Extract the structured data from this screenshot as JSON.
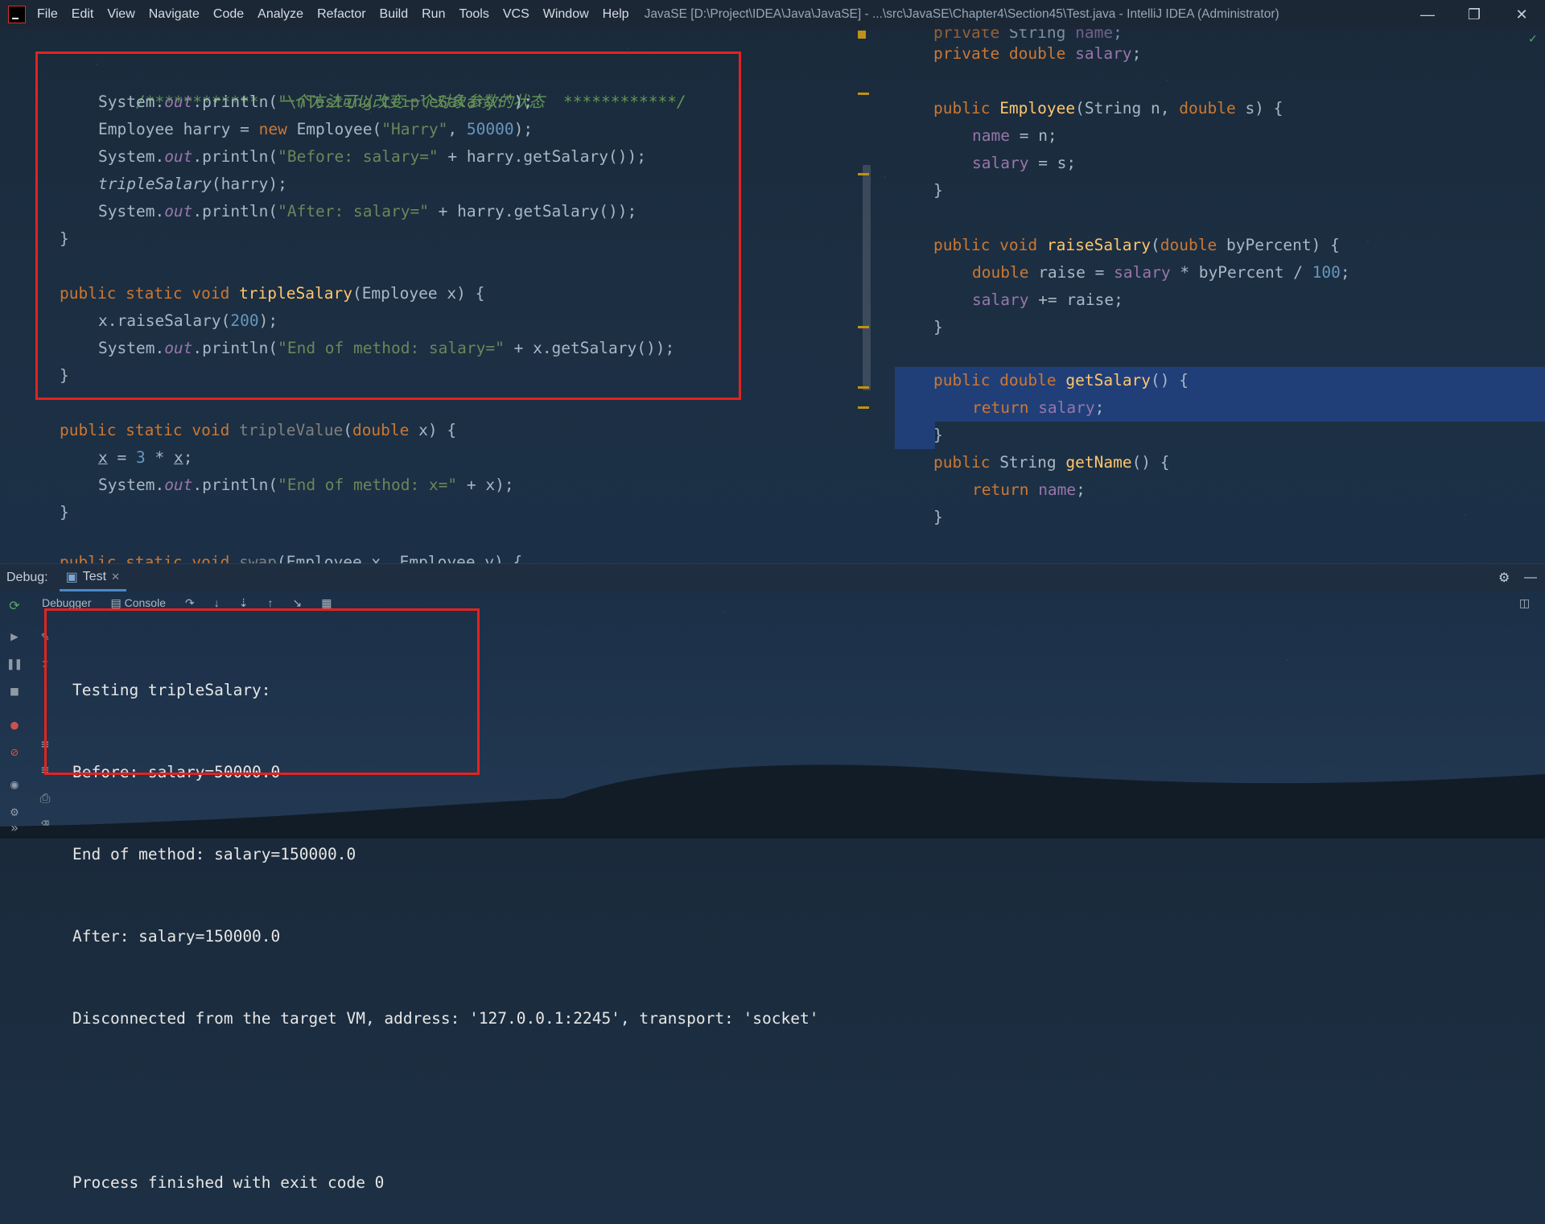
{
  "menubar": {
    "items": [
      "File",
      "Edit",
      "View",
      "Navigate",
      "Code",
      "Analyze",
      "Refactor",
      "Build",
      "Run",
      "Tools",
      "VCS",
      "Window",
      "Help"
    ],
    "title": "JavaSE [D:\\Project\\IDEA\\Java\\JavaSE] - ...\\src\\JavaSE\\Chapter4\\Section45\\Test.java - IntelliJ IDEA (Administrator)"
  },
  "editor_left": {
    "comment": "/************  一个方法可以改变一个对象参数的状态  ************/",
    "l1": {
      "a": "System.",
      "b": "out",
      "c": ".println(",
      "d": "\"\\nTesting tripleSalary:\"",
      "e": ");"
    },
    "l2": {
      "a": "Employee harry = ",
      "b": "new",
      "c": " Employee(",
      "d": "\"Harry\"",
      "e": ", ",
      "f": "50000",
      "g": ");"
    },
    "l3": {
      "a": "System.",
      "b": "out",
      "c": ".println(",
      "d": "\"Before: salary=\"",
      "e": " + harry.getSalary());"
    },
    "l4": {
      "a": "tripleSalary",
      "b": "(harry);"
    },
    "l5": {
      "a": "System.",
      "b": "out",
      "c": ".println(",
      "d": "\"After: salary=\"",
      "e": " + harry.getSalary());"
    },
    "l6": "}",
    "l7": {
      "a": "public static void ",
      "b": "tripleSalary",
      "c": "(Employee x) {"
    },
    "l8": {
      "a": "x.raiseSalary(",
      "b": "200",
      "c": ");"
    },
    "l9": {
      "a": "System.",
      "b": "out",
      "c": ".println(",
      "d": "\"End of method: salary=\"",
      "e": " + x.getSalary());"
    },
    "l10": "}",
    "l11": {
      "a": "public static void ",
      "b": "tripleValue",
      "c": "(",
      "d": "double",
      "e": " x) {"
    },
    "l12": {
      "a": "x",
      "b": " = ",
      "c": "3",
      "d": " * ",
      "e": "x",
      "f": ";"
    },
    "l13": {
      "a": "System.",
      "b": "out",
      "c": ".println(",
      "d": "\"End of method: x=\"",
      "e": " + x);"
    },
    "l14": "}",
    "l15": {
      "a": "public static void ",
      "b": "swap",
      "c": "(Employee x, Employee y) {"
    }
  },
  "editor_right": {
    "r0": {
      "a": "private ",
      "b": "String ",
      "c": "name",
      "d": ";"
    },
    "r1": {
      "a": "private double ",
      "b": "salary",
      "c": ";"
    },
    "r2": {
      "a": "public ",
      "b": "Employee",
      "c": "(String n, ",
      "d": "double",
      "e": " s) {"
    },
    "r3": {
      "a": "name",
      "b": " = n;"
    },
    "r4": {
      "a": "salary",
      "b": " = s;"
    },
    "r5": "}",
    "r6": {
      "a": "public void ",
      "b": "raiseSalary",
      "c": "(",
      "d": "double",
      "e": " byPercent) {"
    },
    "r7": {
      "a": "double",
      "b": " raise = ",
      "c": "salary",
      "d": " * byPercent / ",
      "e": "100",
      "f": ";"
    },
    "r8": {
      "a": "salary",
      "b": " += raise;"
    },
    "r9": "}",
    "r10": {
      "a": "public double ",
      "b": "getSalary",
      "c": "() {"
    },
    "r11": {
      "a": "return ",
      "b": "salary",
      "c": ";"
    },
    "r12": "}",
    "r13": {
      "a": "public ",
      "b": "String ",
      "c": "getName",
      "d": "() {"
    },
    "r14": {
      "a": "return ",
      "b": "name",
      "c": ";"
    },
    "r15": "}"
  },
  "debug": {
    "label": "Debug:",
    "tab": "Test",
    "sub_tabs": [
      "Debugger",
      "Console"
    ]
  },
  "console": {
    "lines": [
      "Testing tripleSalary:",
      "Before: salary=50000.0",
      "End of method: salary=150000.0",
      "After: salary=150000.0",
      "Disconnected from the target VM, address: '127.0.0.1:2245', transport: 'socket'",
      "",
      "Process finished with exit code 0"
    ]
  },
  "colors": {
    "keyword": "#cc7832",
    "string": "#6a8759",
    "number": "#6897bb",
    "field": "#9876aa",
    "method": "#ffc66d",
    "annotation_box": "#e2231f"
  }
}
